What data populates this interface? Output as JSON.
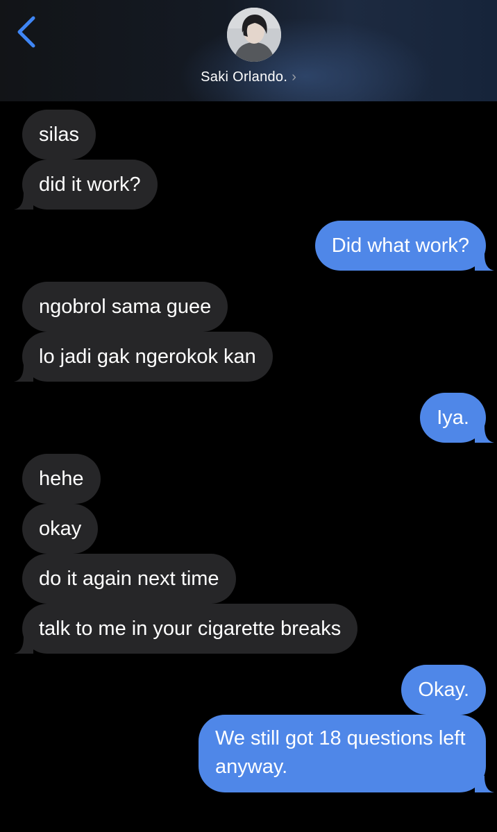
{
  "header": {
    "contact_name": "Saki Orlando.",
    "chevron": "›",
    "back_icon": "chevron-left-icon"
  },
  "colors": {
    "received_bubble": "#262628",
    "sent_bubble": "#4f87e8",
    "accent": "#3f86f5"
  },
  "messages": [
    {
      "from": "them",
      "text": "silas"
    },
    {
      "from": "them",
      "text": "did it work?"
    },
    {
      "from": "me",
      "text": "Did what work?"
    },
    {
      "from": "them",
      "text": "ngobrol sama guee"
    },
    {
      "from": "them",
      "text": "lo jadi gak ngerokok kan"
    },
    {
      "from": "me",
      "text": "Iya."
    },
    {
      "from": "them",
      "text": "hehe"
    },
    {
      "from": "them",
      "text": "okay"
    },
    {
      "from": "them",
      "text": "do it again next time"
    },
    {
      "from": "them",
      "text": "talk to me in your cigarette breaks"
    },
    {
      "from": "me",
      "text": "Okay."
    },
    {
      "from": "me",
      "text": "We still got 18 questions left anyway."
    }
  ]
}
